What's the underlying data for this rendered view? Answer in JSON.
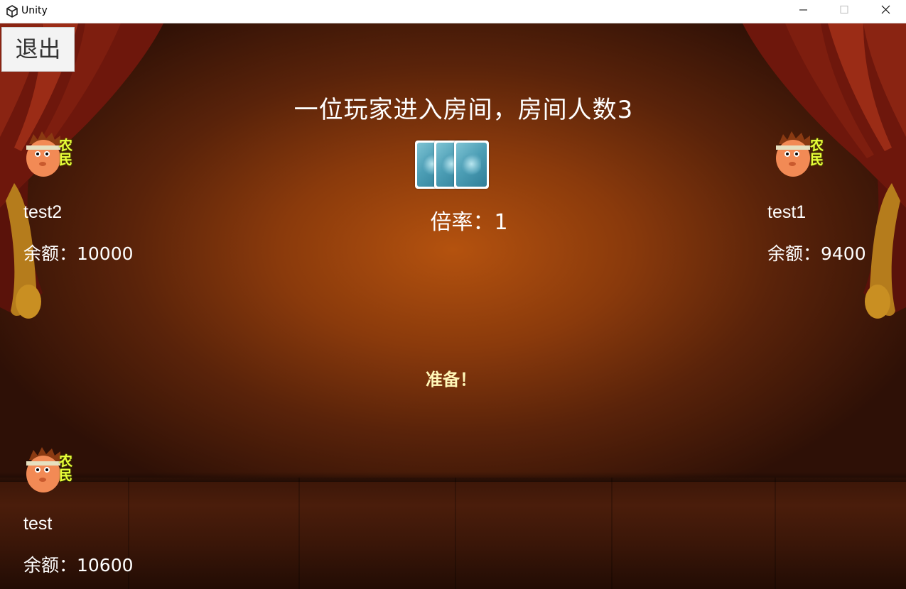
{
  "window": {
    "title": "Unity",
    "icon": "unity-logo-icon",
    "controls": [
      "minimize-icon",
      "maximize-icon",
      "close-icon"
    ]
  },
  "game": {
    "exit_label": "退出",
    "status_message": "一位玩家进入房间，房间人数3",
    "multiplier_label": "倍率：1",
    "ready_label": "准备！",
    "bottom_card_count": 3
  },
  "players": {
    "left": {
      "name": "test2",
      "balance_label": "余额：10000",
      "role": "农民"
    },
    "right": {
      "name": "test1",
      "balance_label": "余额：9400",
      "role": "农民"
    },
    "self": {
      "name": "test",
      "balance_label": "余额：10600",
      "role": "农民"
    }
  },
  "colors": {
    "role_text": "#e8ff3a",
    "ready_text": "#fff7b8",
    "background_center": "#b4520e",
    "background_edge": "#2e1006",
    "curtain": "#7a1a0e"
  }
}
